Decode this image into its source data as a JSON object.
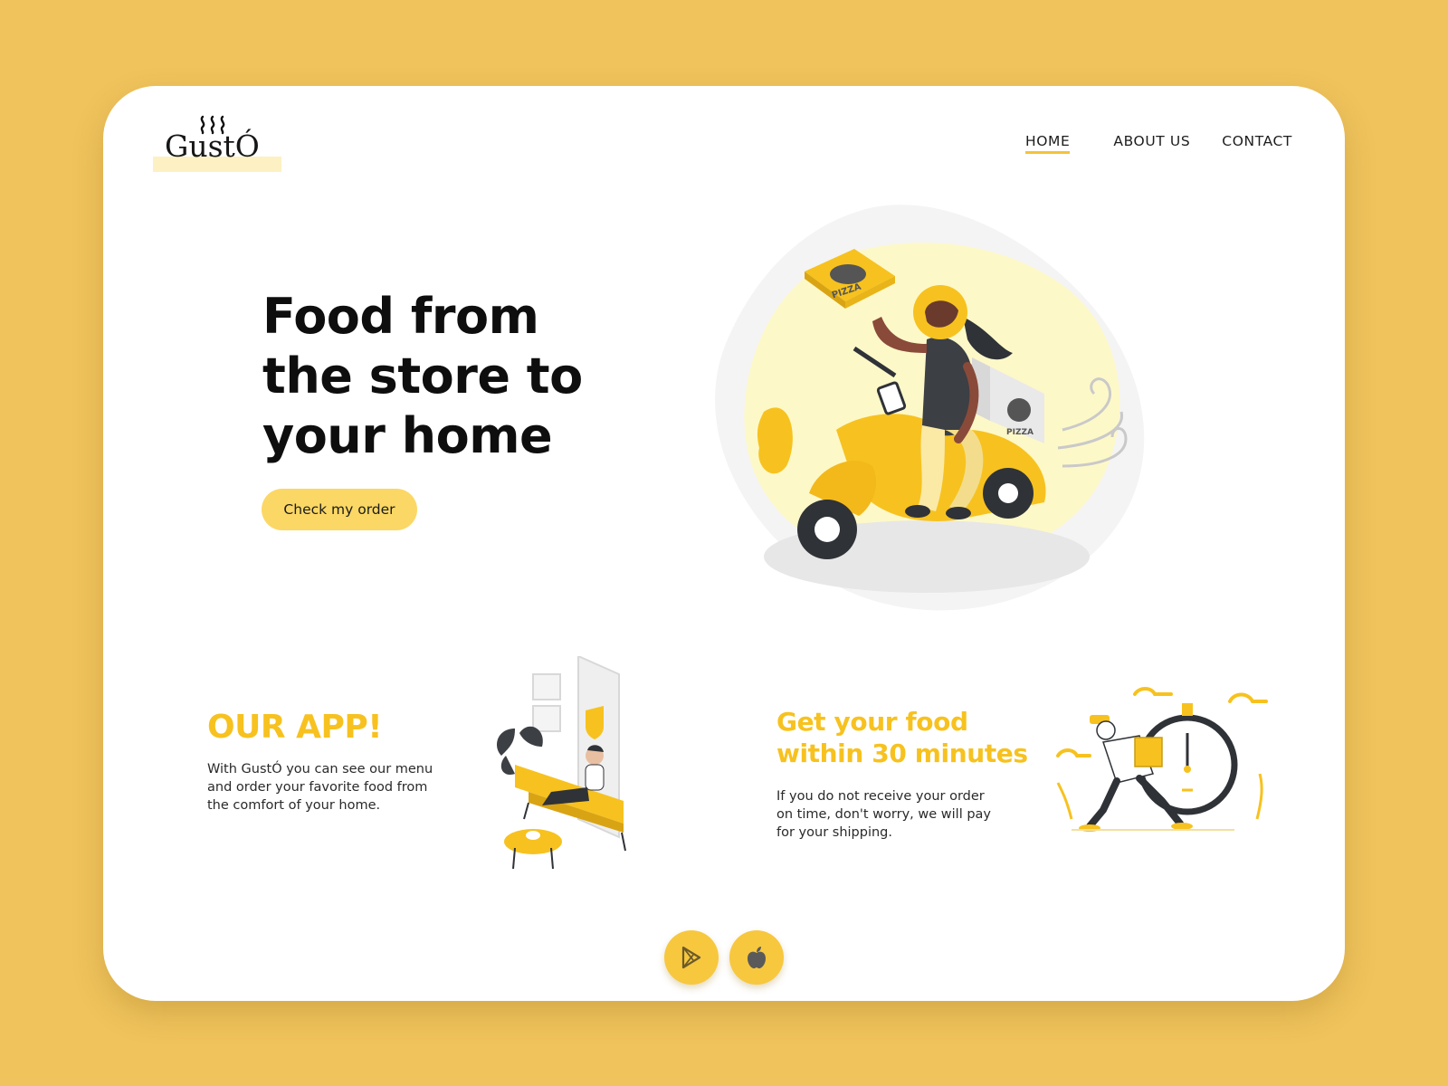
{
  "brand": {
    "logo_text": "GustÓ"
  },
  "nav": {
    "items": [
      {
        "label": "HOME",
        "active": true
      },
      {
        "label": "ABOUT US",
        "active": false
      },
      {
        "label": "CONTACT",
        "active": false
      }
    ]
  },
  "hero": {
    "title": "Food from the store to your home",
    "button_label": "Check my order"
  },
  "app_section": {
    "title": "OUR APP!",
    "text": "With GustÓ you can see our menu and order your favorite food from the comfort of your home."
  },
  "delivery_section": {
    "title": "Get your food within 30 minutes",
    "text": "If you do not receive your order on time, don't worry, we will pay for your shipping."
  },
  "illustration_text": {
    "pizza_box_label": "PIZZA"
  },
  "store_buttons": [
    {
      "icon": "google-play-icon"
    },
    {
      "icon": "apple-icon"
    }
  ],
  "colors": {
    "background": "#f0c35c",
    "accent": "#f7c21f",
    "button": "#fbd765",
    "card": "#ffffff"
  }
}
